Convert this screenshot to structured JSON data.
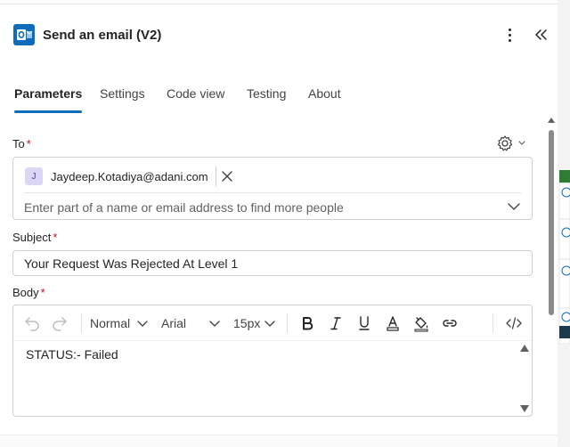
{
  "header": {
    "title": "Send an email (V2)",
    "app_icon": "outlook-icon",
    "more_icon": "more-vertical-icon",
    "collapse_icon": "double-chevron-left-icon"
  },
  "tabs": [
    {
      "label": "Parameters",
      "active": true
    },
    {
      "label": "Settings",
      "active": false
    },
    {
      "label": "Code view",
      "active": false
    },
    {
      "label": "Testing",
      "active": false
    },
    {
      "label": "About",
      "active": false
    }
  ],
  "to": {
    "label": "To",
    "required_mark": "*",
    "recipient_initial": "J",
    "recipient": "Jaydeep.Kotadiya@adani.com",
    "placeholder": "Enter part of a name or email address to find more people"
  },
  "subject": {
    "label": "Subject",
    "required_mark": "*",
    "value": "Your Request Was Rejected At Level 1"
  },
  "body": {
    "label": "Body",
    "required_mark": "*",
    "paragraph_style": "Normal",
    "font": "Arial",
    "size": "15px",
    "content": "STATUS:- Failed"
  },
  "colors": {
    "accent": "#0f6cbd",
    "required": "#c50f1f",
    "outlook_blue": "#0f6cbd"
  }
}
